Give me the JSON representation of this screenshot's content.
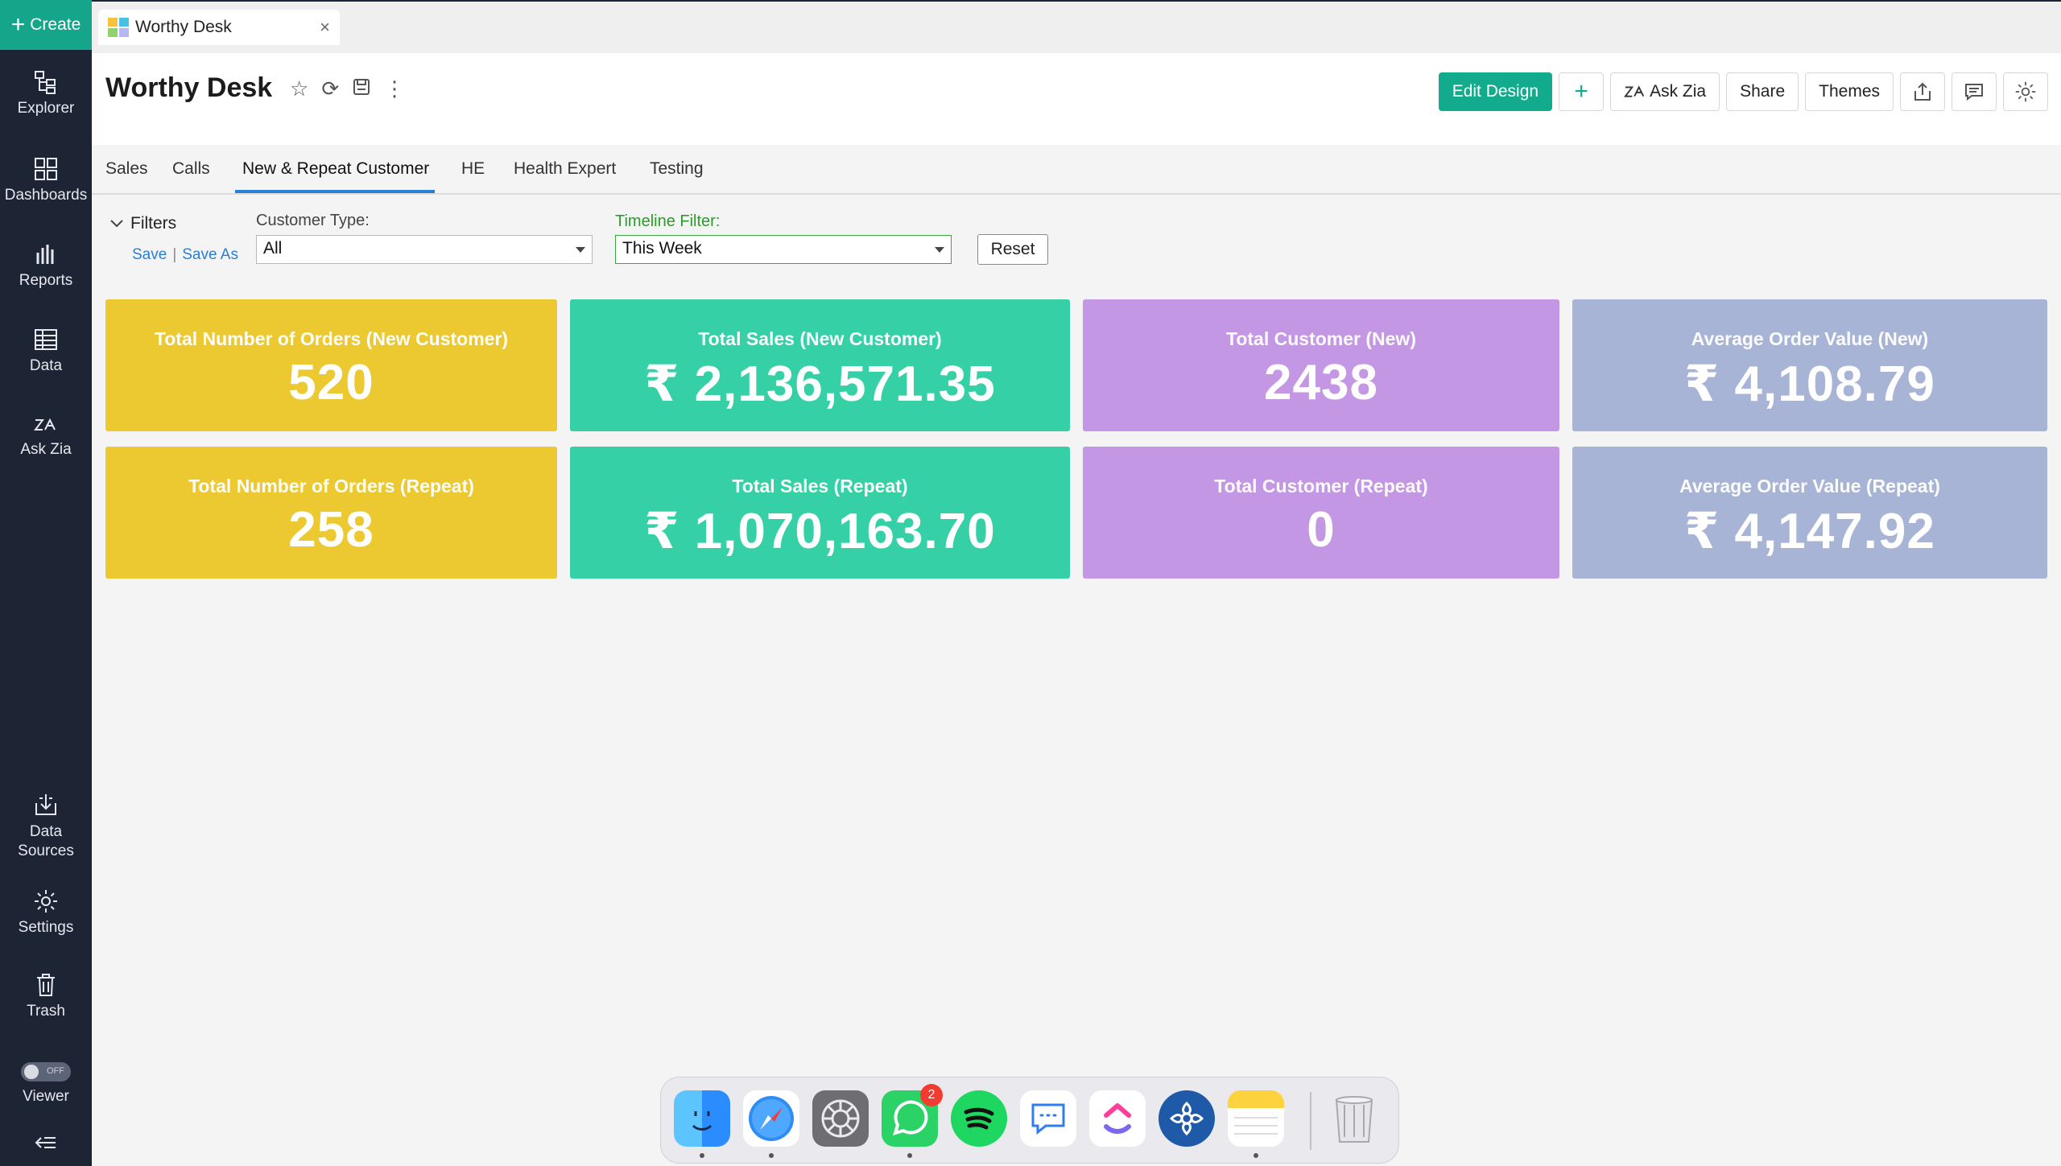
{
  "sidebar": {
    "create_label": "Create",
    "items": [
      {
        "label": "Explorer",
        "icon": "explorer-icon"
      },
      {
        "label": "Dashboards",
        "icon": "dashboards-icon"
      },
      {
        "label": "Reports",
        "icon": "reports-icon"
      },
      {
        "label": "Data",
        "icon": "data-icon"
      },
      {
        "label": "Ask Zia",
        "icon": "zia-icon"
      },
      {
        "label": "Data\nSources",
        "line1": "Data",
        "line2": "Sources",
        "icon": "data-sources-icon"
      },
      {
        "label": "Settings",
        "icon": "gear-icon"
      },
      {
        "label": "Trash",
        "icon": "trash-icon"
      },
      {
        "label": "Viewer",
        "icon": "toggle-icon"
      }
    ],
    "viewer_toggle": "OFF"
  },
  "browser_tab": {
    "title": "Worthy Desk"
  },
  "header": {
    "title": "Worthy Desk",
    "buttons": {
      "edit_design": "Edit Design",
      "ask_zia": "Ask Zia",
      "share": "Share",
      "themes": "Themes"
    }
  },
  "tabs": [
    "Sales",
    "Calls",
    "New & Repeat Customer",
    "HE",
    "Health Expert",
    "Testing"
  ],
  "active_tab": "New & Repeat Customer",
  "filters": {
    "label": "Filters",
    "save": "Save",
    "save_as": "Save As",
    "customer_type_label": "Customer Type:",
    "customer_type_value": "All",
    "timeline_label": "Timeline Filter:",
    "timeline_value": "This Week",
    "reset": "Reset"
  },
  "kpis": [
    {
      "title": "Total Number of Orders (New Customer)",
      "value": "520"
    },
    {
      "title": "Total Sales (New Customer)",
      "value": "₹ 2,136,571.35"
    },
    {
      "title": "Total Customer (New)",
      "value": "2438"
    },
    {
      "title": "Average Order Value (New)",
      "value": "₹ 4,108.79"
    },
    {
      "title": "Total Number of Orders (Repeat)",
      "value": "258"
    },
    {
      "title": "Total Sales (Repeat)",
      "value": "₹ 1,070,163.70"
    },
    {
      "title": "Total Customer (Repeat)",
      "value": "0"
    },
    {
      "title": "Average Order Value (Repeat)",
      "value": "₹ 4,147.92"
    }
  ],
  "colors": {
    "accent": "#12ab8e",
    "sidebar": "#1d2433",
    "card_yellow": "#ecc831",
    "card_teal": "#36d0a7",
    "card_purple": "#c497e4",
    "card_grey": "#a8b4d6",
    "timeline_label": "#2c9a2c"
  },
  "dock": {
    "apps": [
      "finder-icon",
      "safari-icon",
      "system-settings-icon",
      "whatsapp-icon",
      "spotify-icon",
      "messages-icon",
      "clickup-icon",
      "perplexity-icon",
      "notes-icon",
      "trash-icon"
    ],
    "whatsapp_badge": "2"
  }
}
